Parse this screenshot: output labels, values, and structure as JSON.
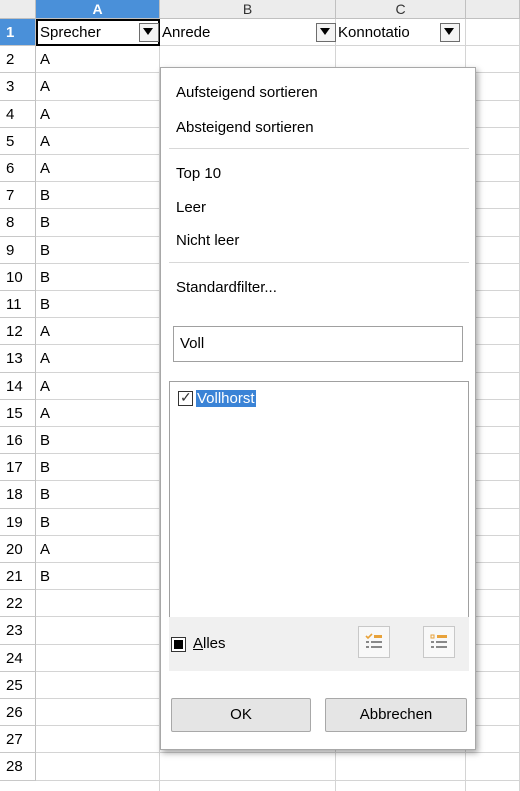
{
  "columns": [
    "A",
    "B",
    "C"
  ],
  "rows": [
    "1",
    "2",
    "3",
    "4",
    "5",
    "6",
    "7",
    "8",
    "9",
    "10",
    "11",
    "12",
    "13",
    "14",
    "15",
    "16",
    "17",
    "18",
    "19",
    "20",
    "21",
    "22",
    "23",
    "24",
    "25",
    "26",
    "27",
    "28"
  ],
  "headers": {
    "a1": "Sprecher",
    "b1": "Anrede",
    "c1": "Konnotatio"
  },
  "column_a_values": [
    "A",
    "A",
    "A",
    "A",
    "A",
    "B",
    "B",
    "B",
    "B",
    "B",
    "A",
    "A",
    "A",
    "A",
    "B",
    "B",
    "B",
    "B",
    "A",
    "B"
  ],
  "autofilter_popup": {
    "sort_ascending": "Aufsteigend sortieren",
    "sort_descending": "Absteigend sortieren",
    "top10": "Top 10",
    "empty": "Leer",
    "not_empty": "Nicht leer",
    "standard_filter": "Standardfilter...",
    "search_value": "Voll",
    "items": [
      {
        "label": "Vollhorst",
        "checked": true
      }
    ],
    "all_label_first": "A",
    "all_label_rest": "lles",
    "ok_label": "OK",
    "cancel_label": "Abbrechen"
  },
  "icons": {
    "dropdown": "chevron-down-icon",
    "select_all": "select-all-icon",
    "deselect_all": "deselect-all-icon"
  },
  "colors": {
    "accent": "#4a90d9",
    "selection": "#3a83d6"
  }
}
